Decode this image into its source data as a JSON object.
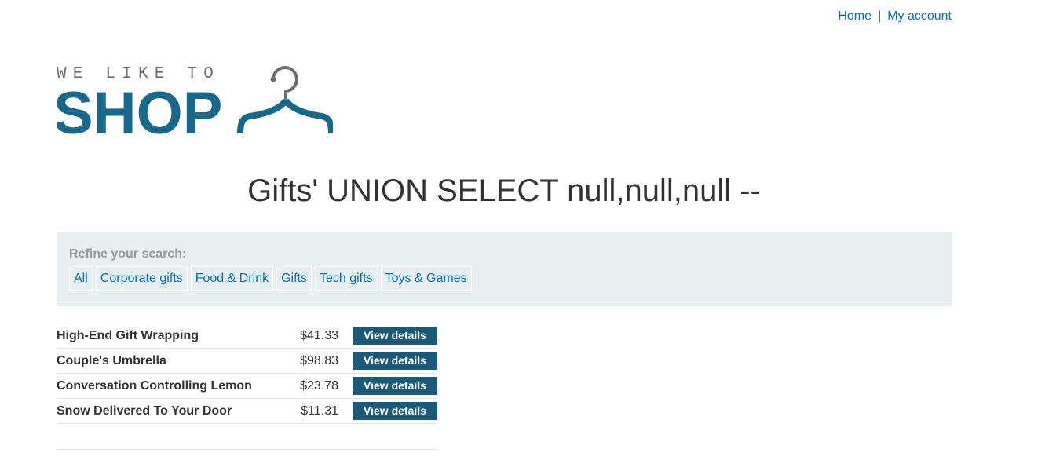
{
  "nav": {
    "home": "Home",
    "separator": "|",
    "account": "My account"
  },
  "logo": {
    "tagline": "WE LIKE TO",
    "wordmark": "SHOP",
    "icon": "coat-hanger-icon",
    "brand_color": "#17688b",
    "tagline_color": "#6e6e6e"
  },
  "page_title": "Gifts' UNION SELECT null,null,null --",
  "filter": {
    "label": "Refine your search:",
    "categories": [
      "All",
      "Corporate gifts",
      "Food & Drink",
      "Gifts",
      "Tech gifts",
      "Toys & Games"
    ]
  },
  "products": [
    {
      "name": "High-End Gift Wrapping",
      "price": "$41.33",
      "action": "View details"
    },
    {
      "name": "Couple's Umbrella",
      "price": "$98.83",
      "action": "View details"
    },
    {
      "name": "Conversation Controlling Lemon",
      "price": "$23.78",
      "action": "View details"
    },
    {
      "name": "Snow Delivered To Your Door",
      "price": "$11.31",
      "action": "View details"
    }
  ],
  "colors": {
    "link": "#0071bc",
    "button": "#1a5a78",
    "panel": "#e9eef1"
  }
}
